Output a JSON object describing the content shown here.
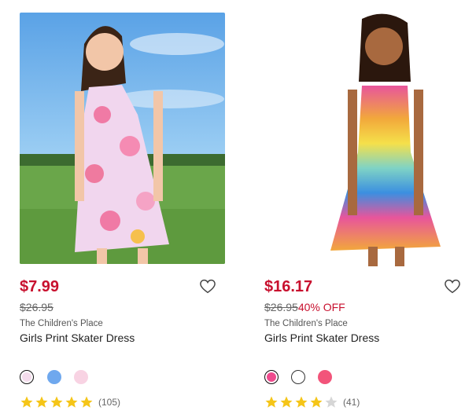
{
  "products": [
    {
      "price": "$7.99",
      "was_price": "$26.95",
      "discount": "",
      "brand": "The Children's Place",
      "name": "Girls Print Skater Dress",
      "swatches": [
        "#f4dcec",
        "#6fa8ee",
        "#f8d3e3"
      ],
      "rating": 5,
      "review_count": "(105)"
    },
    {
      "price": "$16.17",
      "was_price": "$26.95",
      "discount": "40% OFF",
      "brand": "The Children's Place",
      "name": "Girls Print Skater Dress",
      "swatches": [
        "#ef4a8d",
        "#ffffff",
        "#f2547a"
      ],
      "rating": 4,
      "review_count": "(41)"
    }
  ],
  "colors": {
    "price": "#c8102e",
    "star": "#f5c518",
    "star_empty": "#d6d6d6"
  },
  "icons": {
    "wishlist": "heart-outline-icon",
    "rating": "star-icon"
  }
}
